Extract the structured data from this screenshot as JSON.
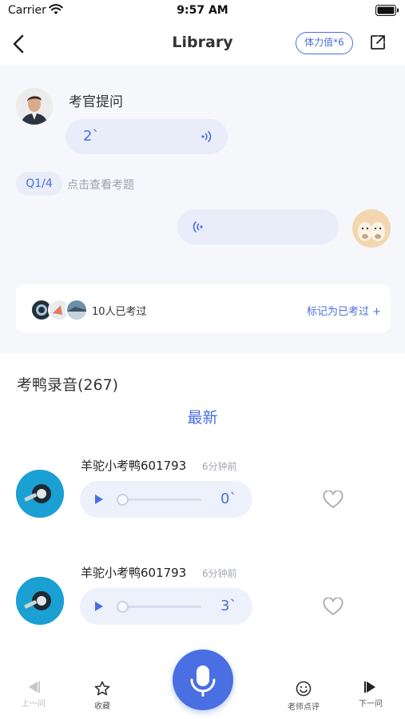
{
  "status_bar": {
    "carrier": "Carrier",
    "time": "9:57 AM"
  },
  "nav": {
    "title": "Library",
    "stamina_badge": "体力值*6"
  },
  "question": {
    "examiner_label": "考官提问",
    "question_duration": "2`",
    "question_index": "Q1/4",
    "view_question_hint": "点击查看考题"
  },
  "taken": {
    "text": "10人已考过",
    "mark_link": "标记为已考过 +"
  },
  "recordings": {
    "title": "考鸭录音(267)",
    "tab_latest": "最新",
    "items": [
      {
        "name": "羊驼小考鸭601793",
        "time_ago": "6分钟前",
        "duration": "0`"
      },
      {
        "name": "羊驼小考鸭601793",
        "time_ago": "6分钟前",
        "duration": "3`"
      }
    ]
  },
  "bottom_bar": {
    "previous": "上一问",
    "favorite": "收藏",
    "teacher_review": "老师点评",
    "next": "下一问"
  },
  "colors": {
    "accent": "#4a6fe3",
    "muted": "#9aa0a8",
    "bubble": "#e8edf9"
  }
}
